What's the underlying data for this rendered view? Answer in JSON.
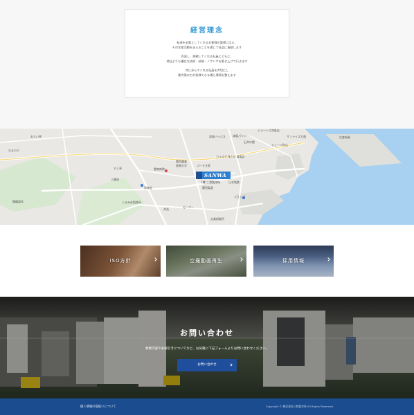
{
  "philosophy": {
    "title": "経営理念",
    "paragraphs": [
      [
        "私達を必要としてくれるお客様の要望に応え、",
        "その生産活動を支えることを通じて社会に貢献します"
      ],
      [
        "売発し、挑戦してくれる社員とともに、",
        "他社よりも優位な技術・技能・ノウハウを築き上げて行きます"
      ],
      [
        "共に歩んでくれる社員を大切にし",
        "最大限の力が発揮できる場と環境を整えます"
      ]
    ]
  },
  "map": {
    "logo": "SANWA",
    "logo_sub": "(株)三和製作所",
    "labels": [
      "おりい亭",
      "ジョーンズ津島店",
      "ひまわり",
      "津島バイパス",
      "津島パイン",
      "石井ゆ館",
      "サンライズ大通",
      "ジェーン和山",
      "生産新拠",
      "すし亭",
      "カラオケ Nさが 津島店",
      "関西職業",
      "医療大学",
      "ゴーすき家",
      "八幡池",
      "雲南病院",
      "日本製鉄",
      "関西製鉄",
      "くるみ台製鉄所",
      "井西",
      "ゼーマー",
      "男衆会",
      "ショップ",
      "吉美創製所",
      "舞鶴製作"
    ]
  },
  "banners": [
    {
      "title": "ISO方針",
      "color": "#6b4a33"
    },
    {
      "title": "空撮動画再生",
      "color": "#55604a"
    },
    {
      "title": "採用情報",
      "color": "#3c4d6c"
    }
  ],
  "contact": {
    "title": "お問い合わせ",
    "description": "事業内容やお取引きについてなど、お気軽に下記フォームよりお問い合わせください。",
    "button_label": "お問い合わせ"
  },
  "footer": {
    "link": "個人情報の取扱いについて",
    "copyright": "Copyright © 株式会社三和製作所 All Rights Reserved."
  }
}
